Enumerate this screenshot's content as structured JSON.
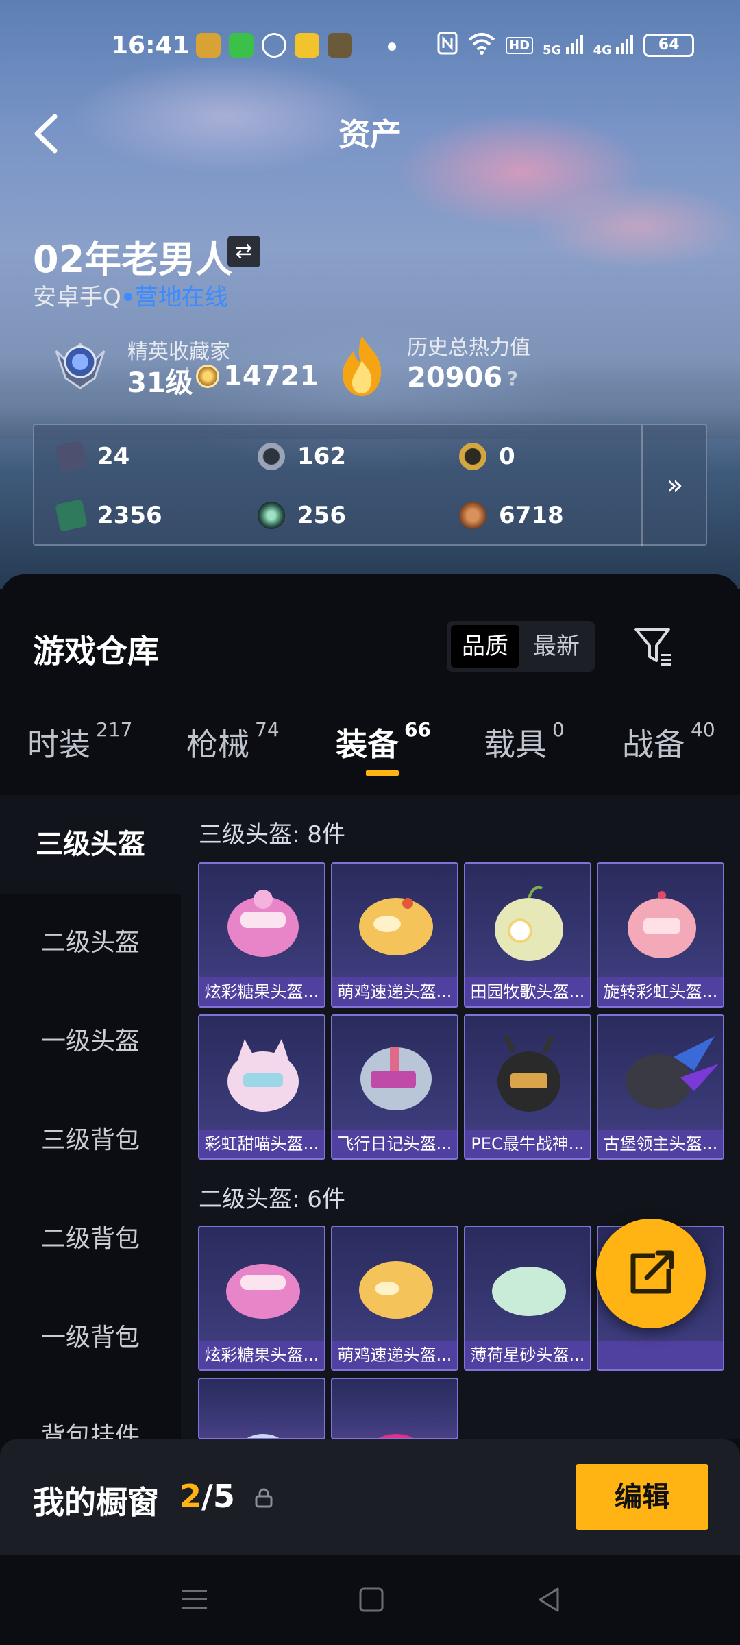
{
  "status_bar": {
    "time": "16:41",
    "icons": [
      "nfc-icon",
      "wifi-icon",
      "hd-icon",
      "5g-signal-icon",
      "4g-signal-icon"
    ],
    "hd_label": "HD",
    "5g_label": "5G",
    "4g_label": "4G",
    "battery": "64"
  },
  "header": {
    "title": "资产",
    "back_icon": "chevron-left-icon"
  },
  "profile": {
    "username": "02年老男人",
    "swap_icon": "swap-icon",
    "platform": "安卓手Q",
    "online_status": "营地在线",
    "rank": {
      "title": "精英收藏家",
      "level": "31级",
      "points": "14721"
    },
    "heat": {
      "title": "历史总热力值",
      "value": "20906",
      "help": "?"
    }
  },
  "currencies": [
    {
      "value": "24",
      "icon": "card-icon",
      "color": "#6a6f8f"
    },
    {
      "value": "162",
      "icon": "coin-s-icon",
      "color": "#8c96a6"
    },
    {
      "value": "0",
      "icon": "coin-a-icon",
      "color": "#c99a3a"
    },
    {
      "value": "2356",
      "icon": "ticket-icon",
      "color": "#3b8c6e"
    },
    {
      "value": "256",
      "icon": "orb-icon",
      "color": "#3c6e5f"
    },
    {
      "value": "6718",
      "icon": "bronze-coin-icon",
      "color": "#a8643a"
    }
  ],
  "currency_more": "»",
  "warehouse": {
    "title": "游戏仓库",
    "sort": [
      "品质",
      "最新"
    ],
    "filter_icon": "filter-icon"
  },
  "tabs": [
    {
      "label": "时装",
      "count": "217"
    },
    {
      "label": "枪械",
      "count": "74"
    },
    {
      "label": "装备",
      "count": "66"
    },
    {
      "label": "载具",
      "count": "0"
    },
    {
      "label": "战备",
      "count": "40"
    }
  ],
  "sidebar": [
    "三级头盔",
    "二级头盔",
    "一级头盔",
    "三级背包",
    "二级背包",
    "一级背包",
    "背包挂件"
  ],
  "groups": [
    {
      "title": "三级头盔: 8件",
      "items": [
        "炫彩糖果头盔...",
        "萌鸡速递头盔...",
        "田园牧歌头盔...",
        "旋转彩虹头盔...",
        "彩虹甜喵头盔...",
        "飞行日记头盔...",
        "PEC最牛战神...",
        "古堡领主头盔..."
      ]
    },
    {
      "title": "二级头盔: 6件",
      "items": [
        "炫彩糖果头盔...",
        "萌鸡速递头盔...",
        "薄荷星砂头盔...",
        "",
        "",
        ""
      ]
    }
  ],
  "showcase": {
    "label": "我的橱窗",
    "current": "2",
    "total": "/5",
    "edit": "编辑"
  },
  "colors": {
    "accent": "#ffb414",
    "online": "#3c8cff",
    "card_border": "#7d74d6"
  }
}
